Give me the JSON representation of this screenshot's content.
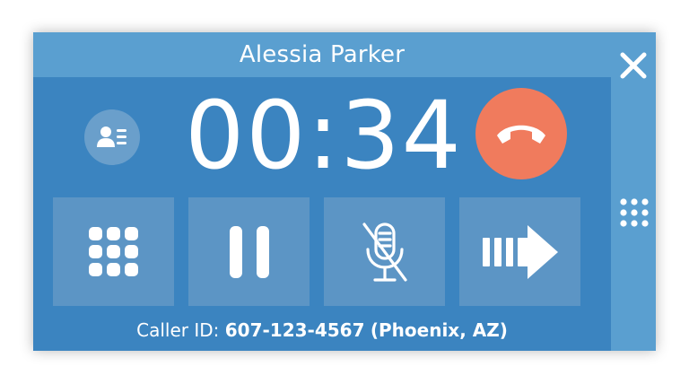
{
  "call": {
    "contact_name": "Alessia Parker",
    "timer": "00:34",
    "caller_id_label": "Caller ID:",
    "caller_id_number": "607-123-4567",
    "caller_id_location": "(Phoenix, AZ)"
  },
  "buttons": [
    {
      "name": "keypad",
      "icon": "keypad-icon"
    },
    {
      "name": "hold",
      "icon": "pause-icon"
    },
    {
      "name": "mute",
      "icon": "mic-off-icon"
    },
    {
      "name": "transfer",
      "icon": "transfer-arrow-icon"
    }
  ],
  "icons": {
    "close": "close-icon",
    "contact": "contact-card-icon",
    "hangup": "hangup-phone-icon",
    "side": "dialpad-grid-icon"
  },
  "colors": {
    "panel": "#3b84c0",
    "header": "#5a9fd0",
    "tile": "#5c95c5",
    "hangup": "#f07b5d",
    "contact_button": "#6a9fcb"
  }
}
